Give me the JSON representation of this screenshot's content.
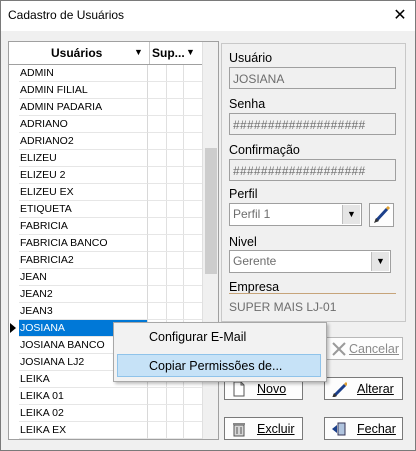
{
  "window": {
    "title": "Cadastro de Usuários",
    "close_glyph": "✕"
  },
  "grid": {
    "columns": [
      {
        "label": "Usuários"
      },
      {
        "label": "Sup..."
      }
    ],
    "sort_arrow": "▼",
    "rows": [
      "ADMIN",
      "ADMIN FILIAL",
      "ADMIN PADARIA",
      "ADRIANO",
      "ADRIANO2",
      "ELIZEU",
      "ELIZEU 2",
      "ELIZEU EX",
      "ETIQUETA",
      "FABRICIA",
      "FABRICIA BANCO",
      "FABRICIA2",
      "JEAN",
      "JEAN2",
      "JEAN3",
      "JOSIANA",
      "JOSIANA BANCO",
      "JOSIANA LJ2",
      "LEIKA",
      "LEIKA 01",
      "LEIKA 02",
      "LEIKA EX"
    ],
    "selected_row": "JOSIANA"
  },
  "form": {
    "usuario": {
      "label": "Usuário",
      "value": "JOSIANA"
    },
    "senha": {
      "label": "Senha",
      "value": "###################"
    },
    "confirmacao": {
      "label": "Confirmação",
      "value": "###################"
    },
    "perfil": {
      "label": "Perfil",
      "value": "Perfil 1"
    },
    "nivel": {
      "label": "Nivel",
      "value": "Gerente"
    },
    "empresa": {
      "label": "Empresa",
      "value": "SUPER MAIS LJ-01"
    }
  },
  "buttons": {
    "cancelar": "Cancelar",
    "novo": "Novo",
    "alterar": "Alterar",
    "excluir": "Excluir",
    "fechar": "Fechar"
  },
  "context_menu": {
    "items": [
      "Configurar E-Mail",
      "Copiar Permissões de..."
    ],
    "highlighted": "Copiar Permissões de..."
  },
  "colors": {
    "selection": "#0078d7",
    "menu_hover": "#c6e2f7"
  }
}
